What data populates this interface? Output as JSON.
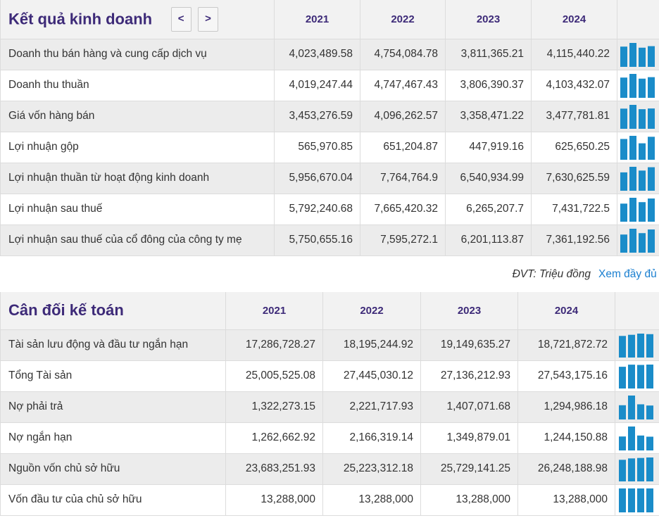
{
  "income": {
    "title": "Kết quả kinh doanh",
    "prev_label": "<",
    "next_label": ">",
    "years": [
      "2021",
      "2022",
      "2023",
      "2024"
    ],
    "rows": [
      {
        "label": "Doanh thu bán hàng và cung cấp dịch vụ",
        "values": [
          "4,023,489.58",
          "4,754,084.78",
          "3,811,365.21",
          "4,115,440.22"
        ]
      },
      {
        "label": "Doanh thu thuần",
        "values": [
          "4,019,247.44",
          "4,747,467.43",
          "3,806,390.37",
          "4,103,432.07"
        ]
      },
      {
        "label": "Giá vốn hàng bán",
        "values": [
          "3,453,276.59",
          "4,096,262.57",
          "3,358,471.22",
          "3,477,781.81"
        ]
      },
      {
        "label": "Lợi nhuận gộp",
        "values": [
          "565,970.85",
          "651,204.87",
          "447,919.16",
          "625,650.25"
        ]
      },
      {
        "label": "Lợi nhuận thuần từ hoạt động kinh doanh",
        "values": [
          "5,956,670.04",
          "7,764,764.9",
          "6,540,934.99",
          "7,630,625.59"
        ]
      },
      {
        "label": "Lợi nhuận sau thuế",
        "values": [
          "5,792,240.68",
          "7,665,420.32",
          "6,265,207.7",
          "7,431,722.5"
        ]
      },
      {
        "label": "Lợi nhuận sau thuế của cổ đông của công ty mẹ",
        "values": [
          "5,750,655.16",
          "7,595,272.1",
          "6,201,113.87",
          "7,361,192.56"
        ]
      }
    ]
  },
  "footer": {
    "unit_label": "ĐVT: Triệu đồng",
    "more_link": "Xem đầy đủ"
  },
  "balance": {
    "title": "Cân đối kế toán",
    "years": [
      "2021",
      "2022",
      "2023",
      "2024"
    ],
    "rows": [
      {
        "label": "Tài sản lưu động và đầu tư ngắn hạn",
        "values": [
          "17,286,728.27",
          "18,195,244.92",
          "19,149,635.27",
          "18,721,872.72"
        ]
      },
      {
        "label": "Tổng Tài sản",
        "values": [
          "25,005,525.08",
          "27,445,030.12",
          "27,136,212.93",
          "27,543,175.16"
        ]
      },
      {
        "label": "Nợ phải trả",
        "values": [
          "1,322,273.15",
          "2,221,717.93",
          "1,407,071.68",
          "1,294,986.18"
        ]
      },
      {
        "label": "Nợ ngắn hạn",
        "values": [
          "1,262,662.92",
          "2,166,319.14",
          "1,349,879.01",
          "1,244,150.88"
        ]
      },
      {
        "label": "Nguồn vốn chủ sở hữu",
        "values": [
          "23,683,251.93",
          "25,223,312.18",
          "25,729,141.25",
          "26,248,188.98"
        ]
      },
      {
        "label": "Vốn đầu tư của chủ sở hữu",
        "values": [
          "13,288,000",
          "13,288,000",
          "13,288,000",
          "13,288,000"
        ]
      }
    ]
  },
  "colors": {
    "title": "#3d2a78",
    "bar": "#1a8cc9",
    "link": "#1a7fd0"
  }
}
